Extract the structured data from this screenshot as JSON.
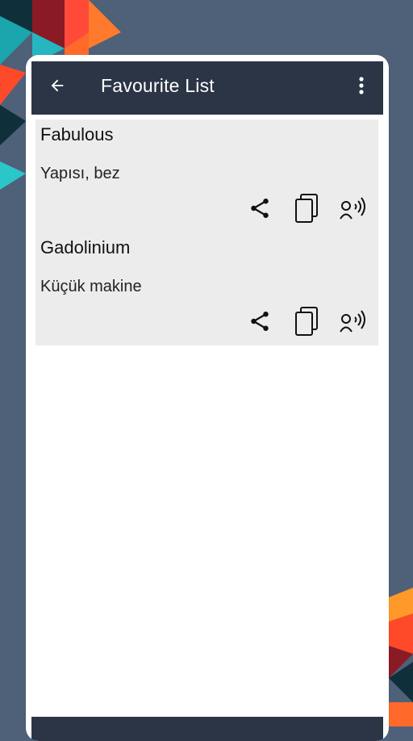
{
  "colors": {
    "page_background": "#4f6079",
    "appbar": "#2c3546",
    "item_background": "#ececec",
    "accent_orange": "#ff6a2b",
    "accent_teal": "#25b6c1",
    "accent_maroon": "#8a1b25"
  },
  "appbar": {
    "title": "Favourite List",
    "back_icon": "arrow-back-icon",
    "menu_icon": "more-vert-icon"
  },
  "items": [
    {
      "word": "Fabulous",
      "meaning": "Yapısı, bez"
    },
    {
      "word": "Gadolinium",
      "meaning": "Küçük makine"
    }
  ],
  "item_actions": {
    "share_icon": "share-icon",
    "copy_icon": "copy-icon",
    "speak_icon": "speak-icon"
  }
}
